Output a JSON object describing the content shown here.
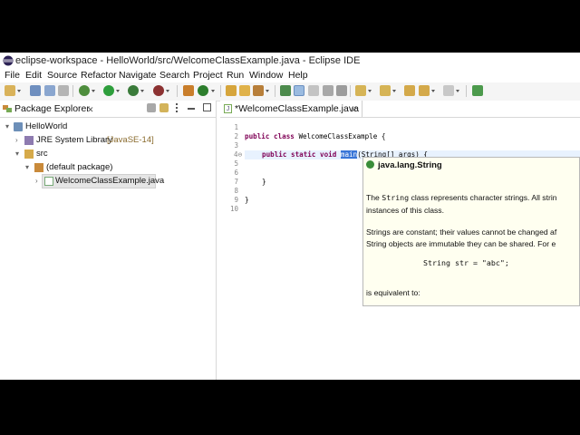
{
  "window": {
    "title": "eclipse-workspace - HelloWorld/src/WelcomeClassExample.java - Eclipse IDE"
  },
  "menu": [
    "File",
    "Edit",
    "Source",
    "Refactor",
    "Navigate",
    "Search",
    "Project",
    "Run",
    "Window",
    "Help"
  ],
  "package_explorer": {
    "tab_label": "Package Explorer",
    "close_glyph": "✕",
    "tree": [
      {
        "label": "HelloWorld",
        "icon": "project-icon"
      },
      {
        "label": "JRE System Library",
        "suffix": "[JavaSE-14]",
        "icon": "library-icon"
      },
      {
        "label": "src",
        "icon": "source-folder-icon"
      },
      {
        "label": "(default package)",
        "icon": "package-icon"
      },
      {
        "label": "WelcomeClassExample.java",
        "icon": "java-file-icon",
        "selected": true
      }
    ]
  },
  "editor": {
    "tab_label": "*WelcomeClassExample.java",
    "line_numbers": [
      "1",
      "2",
      "3",
      "4⊖",
      "5",
      "6",
      "7",
      "8",
      "9",
      "10"
    ],
    "code": {
      "l2_kw1": "public",
      "l2_kw2": "class",
      "l2_rest": " WelcomeClassExample {",
      "l4_kw1": "public",
      "l4_kw2": "static",
      "l4_kw3": "void",
      "l4_sel": "main",
      "l4_rest": "(String[] args) {",
      "l7": "}",
      "l9": "}"
    }
  },
  "hover_popup": {
    "header": "java.lang.String",
    "p1a_pre": "The ",
    "p1a_code": "String",
    "p1a_post": " class represents character strings. All strin",
    "p1b": "instances of this class.",
    "p2a": "Strings are constant; their values cannot be changed af",
    "p2b": "String objects are immutable they can be shared. For e",
    "code": "String str = \"abc\";",
    "p3": "is equivalent to:"
  },
  "colors": {
    "keyword": "#7f0055",
    "selection": "#3875d7",
    "popup_bg": "#fffff0"
  }
}
